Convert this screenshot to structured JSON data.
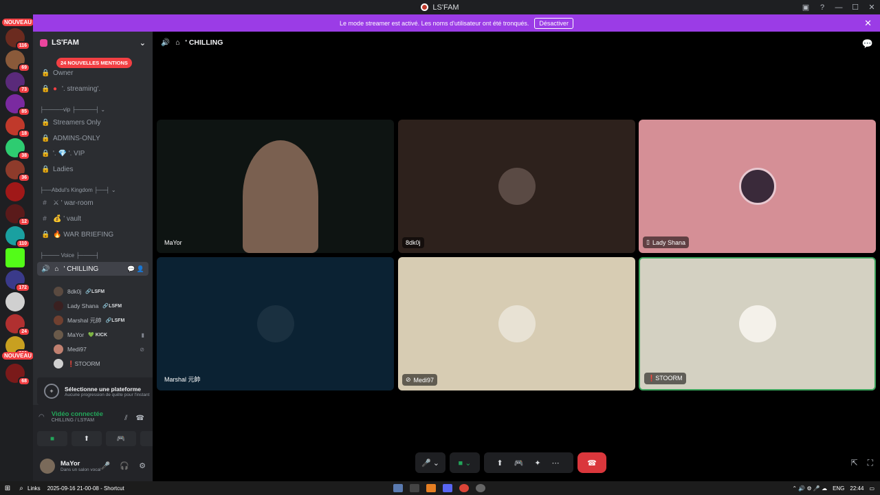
{
  "window": {
    "title": "LS'FAM"
  },
  "banner": {
    "text": "Le mode streamer est activé. Les noms d'utilisateur ont été tronqués.",
    "button": "Désactiver"
  },
  "guilds": {
    "nouveau_label": "NOUVEAU",
    "badges": [
      "116",
      "69",
      "73",
      "85",
      "18",
      "38",
      "36",
      "",
      "12",
      "110",
      "",
      "172",
      "",
      "24",
      "220",
      "68"
    ]
  },
  "server": {
    "name": "LS'FAM"
  },
  "mention_pill": "24 NOUVELLES MENTIONS",
  "channels": {
    "owner": "Owner",
    "streaming": "'. streaming'.",
    "cat_vip": "├─────vip ├─────┤ ⌄",
    "streamers_only": "Streamers Only",
    "admins_only": "ADMINS-ONLY",
    "vip": "'. 💎 '. VIP",
    "ladies": "Ladies",
    "cat_kingdom": "├──Abdul's Kingdom ├──┤ ⌄",
    "war_room": "⚔ ' war-room",
    "vault": "💰 ' vault",
    "war_briefing": "🔥 WAR BRIEFING",
    "cat_voice": "├──── Voice ├────┤",
    "chilling": "' CHILLING"
  },
  "voice_users": [
    {
      "name": "8dk0j",
      "tag": "🔗LSFM"
    },
    {
      "name": "Lady Shana",
      "tag": "🔗LSFM"
    },
    {
      "name": "Marshal 元帥",
      "tag": "🔗LSFM"
    },
    {
      "name": "MaYor",
      "tag": "💚 KICK"
    },
    {
      "name": "Medi97",
      "tag": ""
    },
    {
      "name": "❗STOORM",
      "tag": ""
    }
  ],
  "platform": {
    "title": "Sélectionne une plateforme",
    "subtitle": "Aucune progression de quête pour l'instant"
  },
  "voice_status": {
    "title": "Vidéo connectée",
    "subtitle": "CHILLING / LS'FAM"
  },
  "user": {
    "name": "MaYor",
    "status": "Dans un salon vocal"
  },
  "main": {
    "channel": "' CHILLING"
  },
  "tiles": [
    {
      "name": "MaYor"
    },
    {
      "name": "8dk0j"
    },
    {
      "name": "Lady Shana"
    },
    {
      "name": "Marshal 元帥"
    },
    {
      "name": "Medi97"
    },
    {
      "name": "❗STOORM"
    }
  ],
  "taskbar": {
    "links": "Links",
    "shortcut": "2025-09-16 21-00-08 - Shortcut",
    "lang": "ENG",
    "time": "22:44"
  },
  "colors": {
    "banner": "#9b3ce6",
    "connected": "#23a55a",
    "hangup": "#da373c",
    "mention": "#f23f43"
  }
}
